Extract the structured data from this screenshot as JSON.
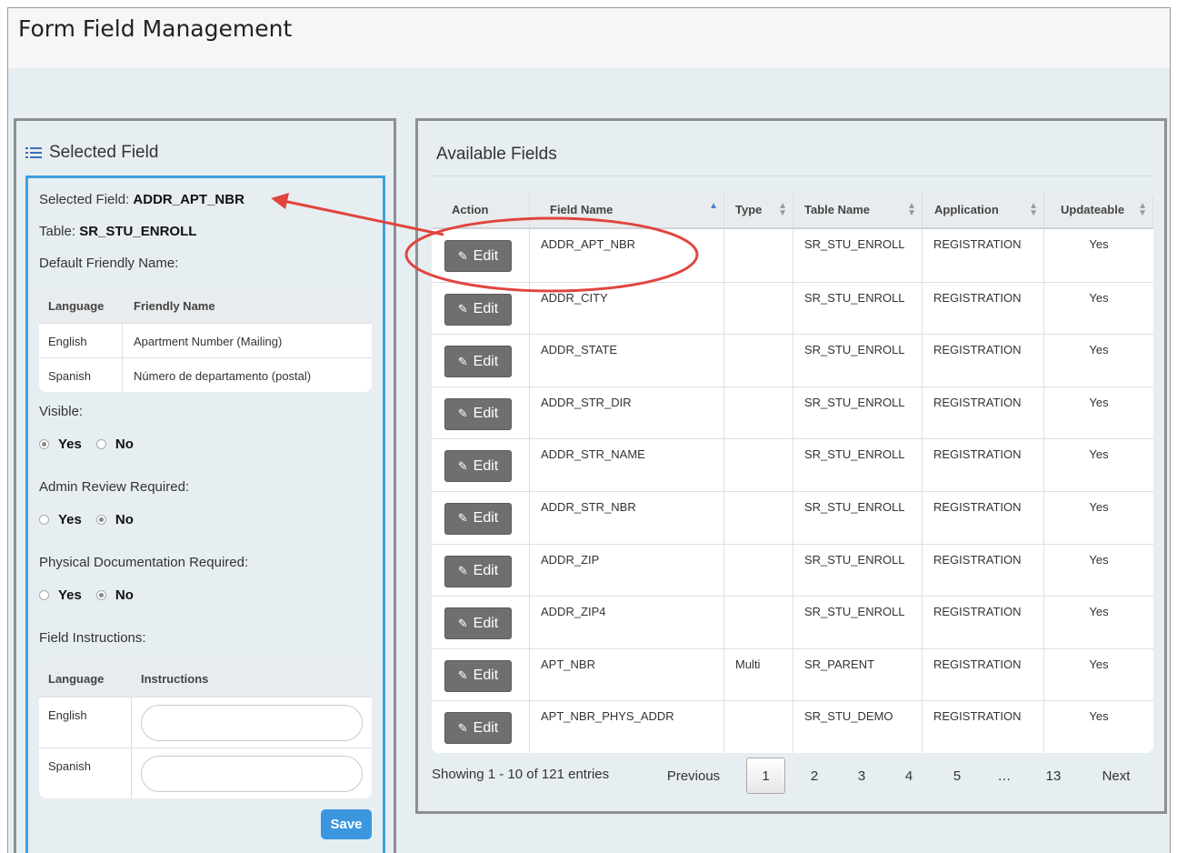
{
  "page": {
    "title": "Form Field Management"
  },
  "left": {
    "header": "Selected Field",
    "selected_field_label": "Selected Field:",
    "selected_field_value": "ADDR_APT_NBR",
    "table_label": "Table:",
    "table_value": "SR_STU_ENROLL",
    "default_friendly_name_label": "Default Friendly Name:",
    "friendly_table": {
      "headers": [
        "Language",
        "Friendly Name"
      ],
      "rows": [
        [
          "English",
          "Apartment Number (Mailing)"
        ],
        [
          "Spanish",
          "Número de departamento (postal)"
        ]
      ]
    },
    "visible": {
      "label": "Visible:",
      "yes": "Yes",
      "no": "No",
      "selected": "Yes"
    },
    "admin_review": {
      "label": "Admin Review Required:",
      "yes": "Yes",
      "no": "No",
      "selected": "No"
    },
    "physical_doc": {
      "label": "Physical Documentation Required:",
      "yes": "Yes",
      "no": "No",
      "selected": "No"
    },
    "field_instructions_label": "Field Instructions:",
    "instructions_table": {
      "headers": [
        "Language",
        "Instructions"
      ],
      "rows": [
        {
          "language": "English",
          "value": ""
        },
        {
          "language": "Spanish",
          "value": ""
        }
      ]
    },
    "save_label": "Save"
  },
  "right": {
    "header": "Available Fields",
    "columns": [
      "Action",
      "Field Name",
      "Type",
      "Table Name",
      "Application",
      "Updateable"
    ],
    "edit_label": "Edit",
    "rows": [
      {
        "field": "ADDR_APT_NBR",
        "type": "",
        "table": "SR_STU_ENROLL",
        "app": "REGISTRATION",
        "upd": "Yes"
      },
      {
        "field": "ADDR_CITY",
        "type": "",
        "table": "SR_STU_ENROLL",
        "app": "REGISTRATION",
        "upd": "Yes"
      },
      {
        "field": "ADDR_STATE",
        "type": "",
        "table": "SR_STU_ENROLL",
        "app": "REGISTRATION",
        "upd": "Yes"
      },
      {
        "field": "ADDR_STR_DIR",
        "type": "",
        "table": "SR_STU_ENROLL",
        "app": "REGISTRATION",
        "upd": "Yes"
      },
      {
        "field": "ADDR_STR_NAME",
        "type": "",
        "table": "SR_STU_ENROLL",
        "app": "REGISTRATION",
        "upd": "Yes"
      },
      {
        "field": "ADDR_STR_NBR",
        "type": "",
        "table": "SR_STU_ENROLL",
        "app": "REGISTRATION",
        "upd": "Yes"
      },
      {
        "field": "ADDR_ZIP",
        "type": "",
        "table": "SR_STU_ENROLL",
        "app": "REGISTRATION",
        "upd": "Yes"
      },
      {
        "field": "ADDR_ZIP4",
        "type": "",
        "table": "SR_STU_ENROLL",
        "app": "REGISTRATION",
        "upd": "Yes"
      },
      {
        "field": "APT_NBR",
        "type": "Multi",
        "table": "SR_PARENT",
        "app": "REGISTRATION",
        "upd": "Yes"
      },
      {
        "field": "APT_NBR_PHYS_ADDR",
        "type": "",
        "table": "SR_STU_DEMO",
        "app": "REGISTRATION",
        "upd": "Yes"
      }
    ],
    "showing": "Showing 1 - 10 of 121 entries",
    "pagination": {
      "previous": "Previous",
      "pages": [
        "1",
        "2",
        "3",
        "4",
        "5",
        "…",
        "13"
      ],
      "active": "1",
      "next": "Next"
    }
  },
  "colors": {
    "accent_blue": "#3fa0e0",
    "save_blue": "#3b96e0",
    "edit_gray": "#6f6f6f",
    "callout_red": "#e0453e",
    "panel_bg": "#e7eef1"
  }
}
